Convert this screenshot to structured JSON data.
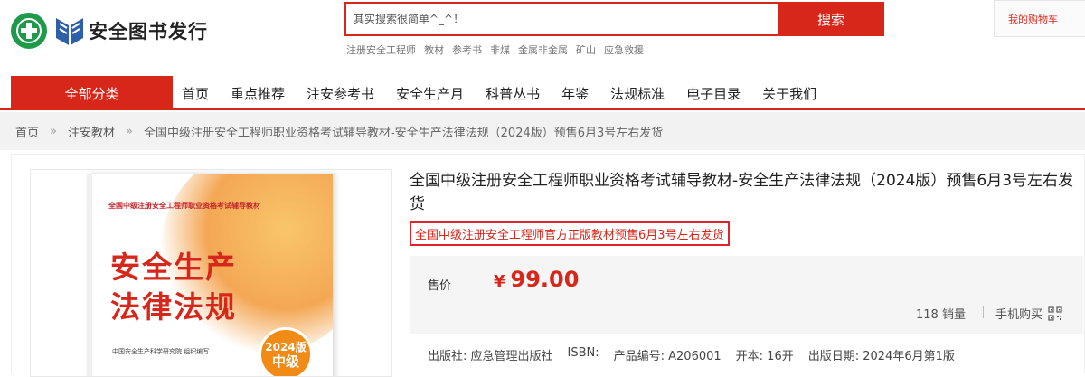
{
  "header": {
    "logo_text": "安全图书发行",
    "search": {
      "placeholder": "其实搜索很简单^_^！",
      "button_label": "搜索"
    },
    "hot_words": [
      "注册安全工程师",
      "教材",
      "参考书",
      "非煤",
      "金属非金属",
      "矿山",
      "应急救援"
    ],
    "cart_label": "我的购物车"
  },
  "nav": {
    "all_categories": "全部分类",
    "items": [
      "首页",
      "重点推荐",
      "注安参考书",
      "安全生产月",
      "科普丛书",
      "年鉴",
      "法规标准",
      "电子目录",
      "关于我们"
    ]
  },
  "breadcrumb": {
    "home": "首页",
    "category": "注安教材",
    "separator": "»",
    "current": "全国中级注册安全工程师职业资格考试辅导教材-安全生产法律法规（2024版）预售6月3号左右发货"
  },
  "product": {
    "title": "全国中级注册安全工程师职业资格考试辅导教材-安全生产法律法规（2024版）预售6月3号左右发货",
    "promo": "全国中级注册安全工程师官方正版教材预售6月3号左右发货",
    "price_label": "售价",
    "currency": "¥",
    "price": "99.00",
    "sales": "118 销量",
    "mobile_buy": "手机购买",
    "meta": {
      "publisher": "出版社: 应急管理出版社",
      "isbn": "ISBN:",
      "product_no": "产品编号: A206001",
      "format": "开本: 16开",
      "pub_date": "出版日期: 2024年6月第1版"
    },
    "cover": {
      "series": "全国中级注册安全工程师职业资格考试辅导教材",
      "title_line1": "安全生产",
      "title_line2": "法律法规",
      "publisher": "中国安全生产科学研究院 组织编写",
      "badge_year": "2024版",
      "badge_level": "中级"
    }
  },
  "colors": {
    "brand_red": "#d7271b",
    "logo_green": "#1f9a4a",
    "badge_orange": "#f28a16"
  }
}
